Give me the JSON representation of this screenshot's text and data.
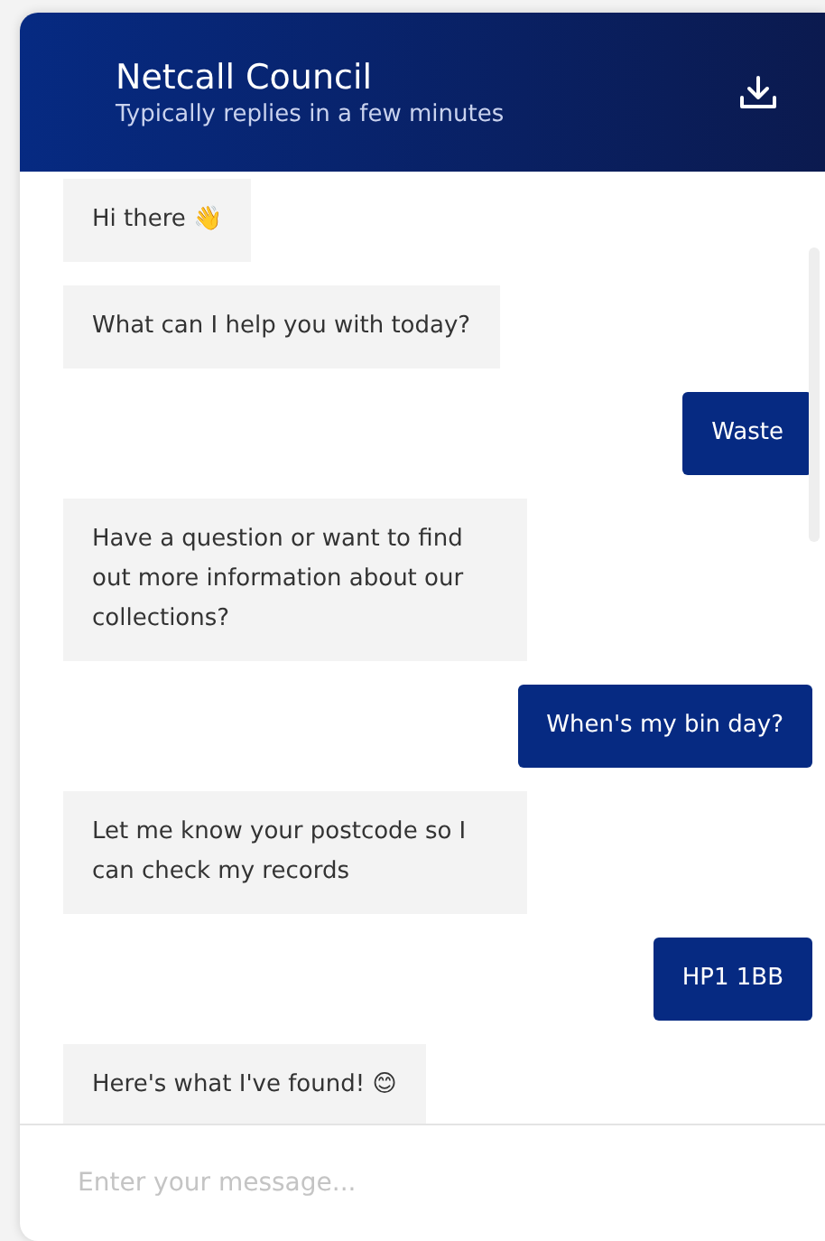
{
  "header": {
    "title": "Netcall Council",
    "subtitle": "Typically replies in a few minutes"
  },
  "messages": [
    {
      "kind": "bot",
      "text": "Hi there 👋"
    },
    {
      "kind": "bot",
      "text": "What can I help you with today?"
    },
    {
      "kind": "user",
      "text": "Waste"
    },
    {
      "kind": "bot",
      "text": "Have a question or want to find out more information about our collections?"
    },
    {
      "kind": "user",
      "text": "When's my bin day?"
    },
    {
      "kind": "bot",
      "text": "Let me know your postcode so I can check my records"
    },
    {
      "kind": "user",
      "text": "HP1 1BB"
    },
    {
      "kind": "bot",
      "text": "Here's what I've found! 😊"
    }
  ],
  "composer": {
    "placeholder": "Enter your message..."
  }
}
